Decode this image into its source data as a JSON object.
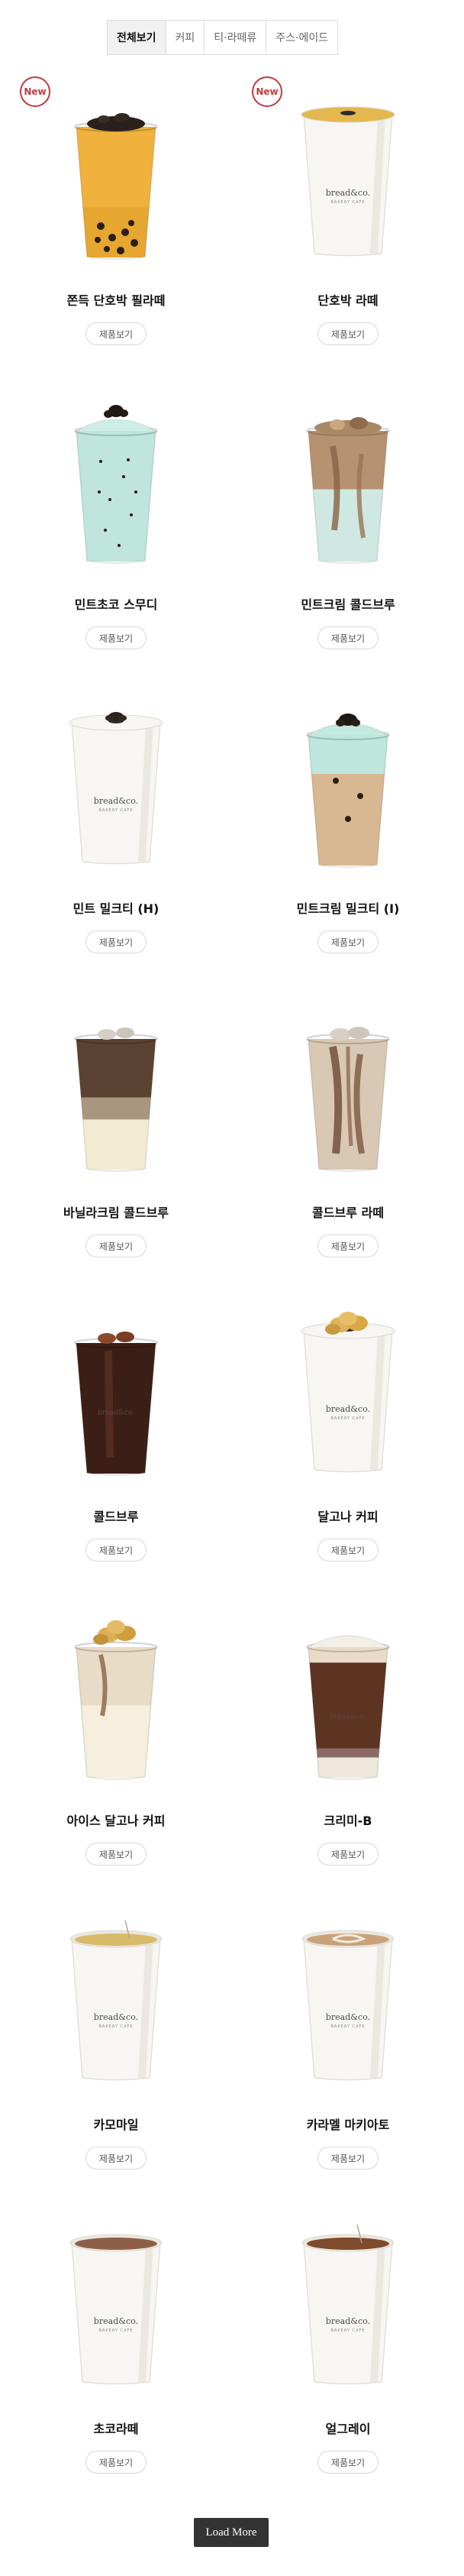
{
  "tabs": [
    {
      "label": "전체보기",
      "active": true
    },
    {
      "label": "커피",
      "active": false
    },
    {
      "label": "티·라떼류",
      "active": false
    },
    {
      "label": "주스·에이드",
      "active": false
    }
  ],
  "badge_label": "New",
  "view_label": "제품보기",
  "products": [
    {
      "name": "쫀득 단호박 필라떼",
      "is_new": true,
      "style": "pumpkin-pearl"
    },
    {
      "name": "단호박 라떼",
      "is_new": true,
      "style": "pumpkin-lid"
    },
    {
      "name": "민트초코 스무디",
      "is_new": false,
      "style": "mint-smoothie"
    },
    {
      "name": "민트크림 콜드브루",
      "is_new": false,
      "style": "mint-coldbrew"
    },
    {
      "name": "민트 밀크티 (H)",
      "is_new": false,
      "style": "hot-paper-lid"
    },
    {
      "name": "민트크림 밀크티 (I)",
      "is_new": false,
      "style": "mint-milktea"
    },
    {
      "name": "바닐라크림 콜드브루",
      "is_new": false,
      "style": "vanilla-coldbrew"
    },
    {
      "name": "콜드브루 라떼",
      "is_new": false,
      "style": "coldbrew-latte"
    },
    {
      "name": "콜드브루",
      "is_new": false,
      "style": "coldbrew"
    },
    {
      "name": "달고나 커피",
      "is_new": false,
      "style": "dalgona-white"
    },
    {
      "name": "아이스 달고나 커피",
      "is_new": false,
      "style": "iced-dalgona"
    },
    {
      "name": "크리미-B",
      "is_new": false,
      "style": "creamy-b"
    },
    {
      "name": "카모마일",
      "is_new": false,
      "style": "hot-tea-yellow"
    },
    {
      "name": "카라멜 마키아토",
      "is_new": false,
      "style": "hot-foam"
    },
    {
      "name": "초코라떼",
      "is_new": false,
      "style": "hot-choco"
    },
    {
      "name": "얼그레이",
      "is_new": false,
      "style": "hot-tea-brown"
    }
  ],
  "load_more_label": "Load More",
  "colors": {
    "badge": "#c53a3f",
    "load_more_bg": "#333333"
  }
}
